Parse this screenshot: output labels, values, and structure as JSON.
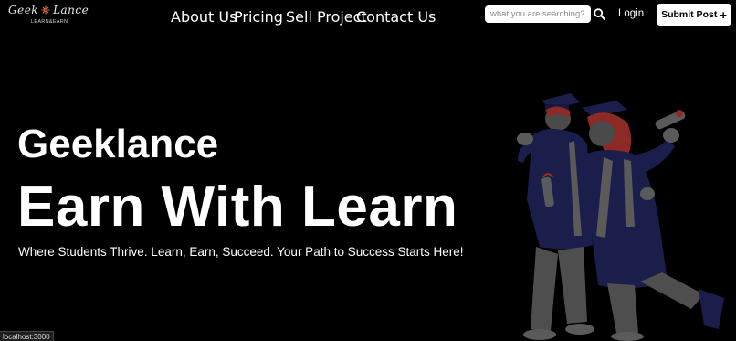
{
  "header": {
    "logo": {
      "text_left": "Geek",
      "text_right": "Lance",
      "subtitle": "LEARN&EARN",
      "flower_icon": "flower-icon"
    },
    "nav": [
      {
        "label": "About Us"
      },
      {
        "label": "Pricing"
      },
      {
        "label": "Sell Project"
      },
      {
        "label": "Contact Us"
      }
    ],
    "search": {
      "placeholder": "what you are searching?",
      "value": "",
      "icon": "search-icon"
    },
    "login_label": "Login",
    "submit_post": {
      "label": "Submit Post",
      "icon": "plus-icon"
    }
  },
  "hero": {
    "kicker": "Geeklance",
    "title": "Earn With Learn",
    "tagline": "Where Students Thrive. Learn, Earn, Succeed. Your Path to Success Starts Here!",
    "illustration": "graduates-celebrating-illustration"
  },
  "status_bar": {
    "url": "localhost:3000"
  },
  "colors": {
    "background": "#000000",
    "text": "#ffffff",
    "illustration_navy": "#1b1d4a",
    "illustration_red": "#b3312a",
    "illustration_gray": "#5a5a5a"
  }
}
